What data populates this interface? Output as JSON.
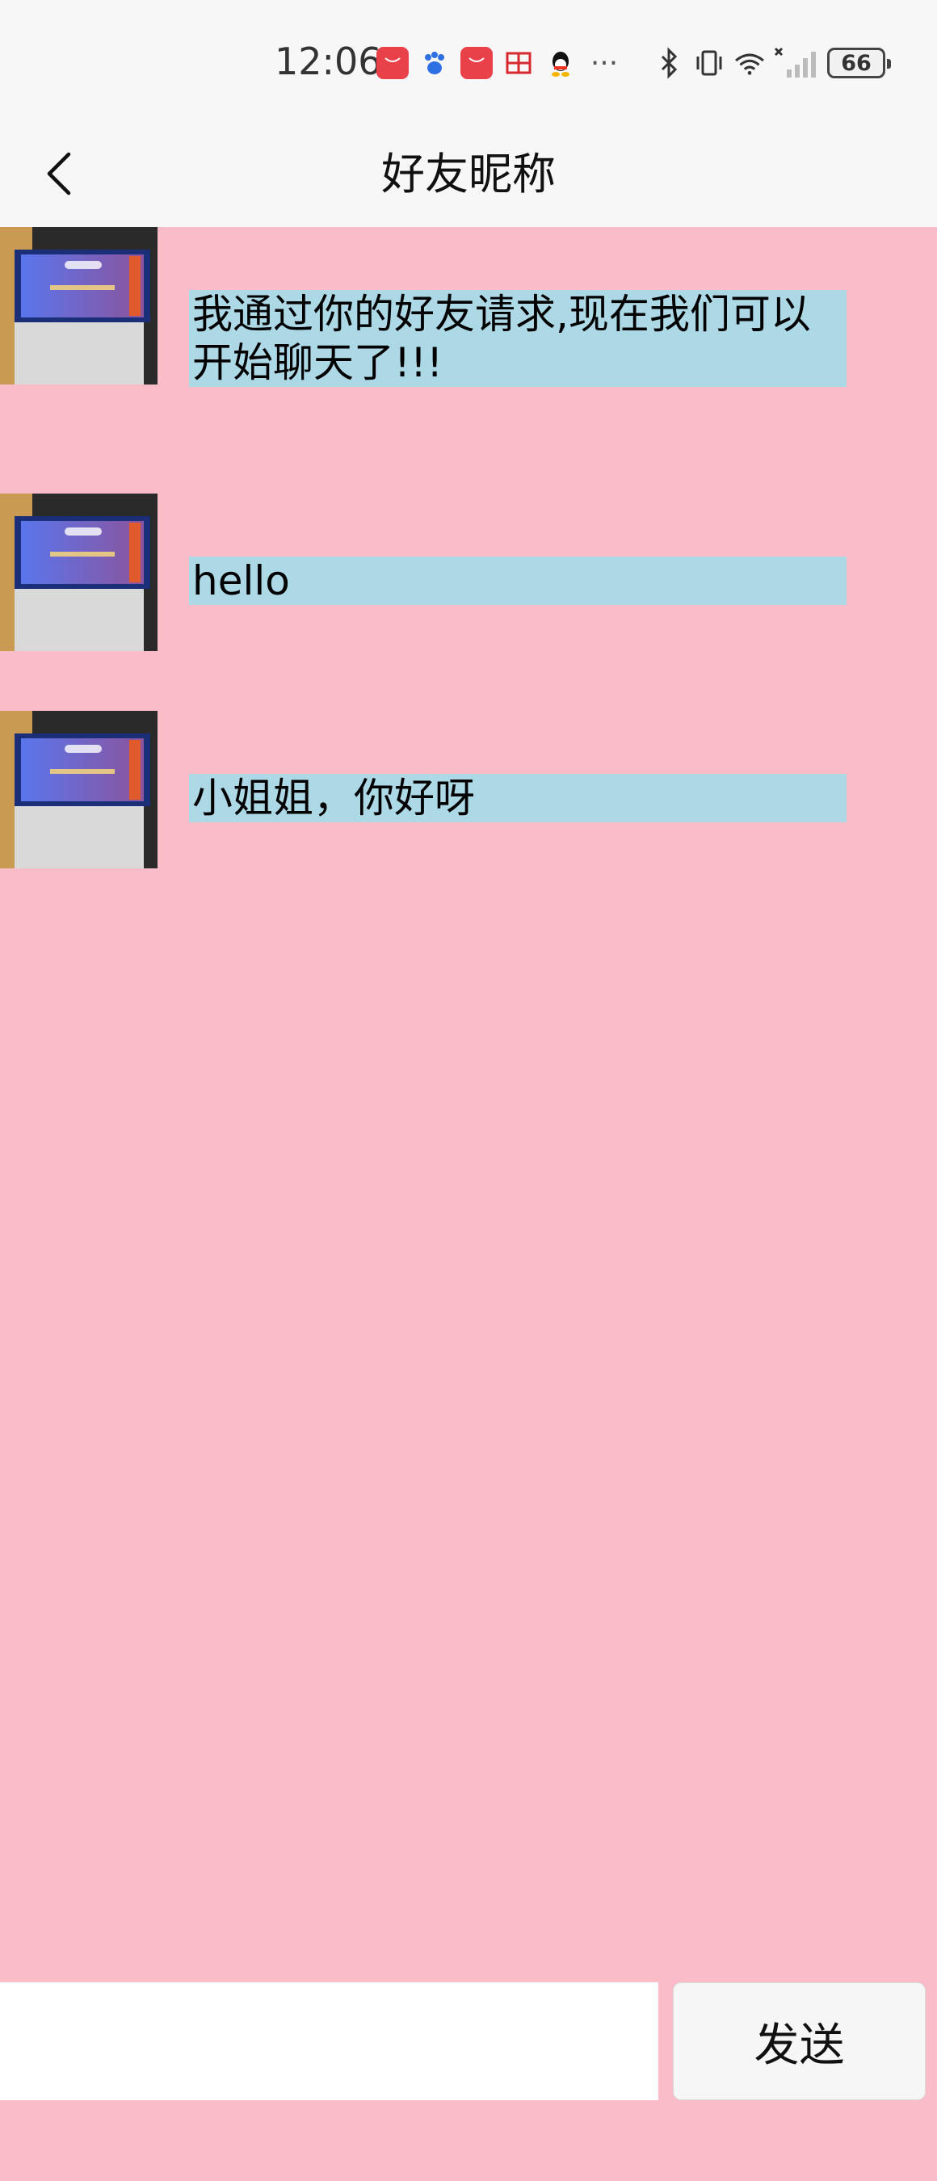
{
  "status_bar": {
    "time": "12:06",
    "notification_icons": [
      "huawei-appgallery-icon",
      "baidu-icon",
      "huawei-appgallery-icon",
      "mail-icon",
      "qq-icon",
      "more-icon"
    ],
    "system_icons": [
      "bluetooth-icon",
      "vibrate-icon",
      "wifi-icon",
      "signal-icon"
    ],
    "battery": "66"
  },
  "nav": {
    "title": "好友昵称"
  },
  "messages": [
    {
      "text": "我通过你的好友请求,现在我们可以开始聊天了!!!"
    },
    {
      "text": "hello"
    },
    {
      "text": "小姐姐，你好呀"
    }
  ],
  "input": {
    "value": "",
    "send_label": "发送"
  },
  "colors": {
    "background": "#fbbcc9",
    "bubble": "#add8e6",
    "bar": "#f7f7f7"
  }
}
